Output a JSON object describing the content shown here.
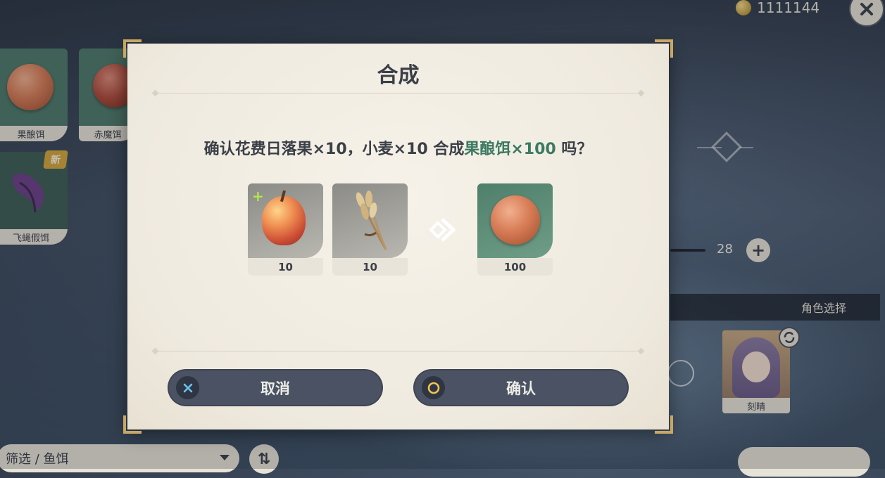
{
  "currency": {
    "amount": "1111144"
  },
  "left_cards": [
    {
      "label": "果酿饵"
    },
    {
      "label": "赤魔饵"
    },
    {
      "label": "飞蝇假饵",
      "badge": "新"
    }
  ],
  "right_panel": {
    "quantity": "28",
    "character_header": "角色选择",
    "character_name": "刻晴"
  },
  "filter": {
    "label": "筛选 / 鱼饵"
  },
  "dialog": {
    "title": "合成",
    "prompt_prefix": "确认花费日落果×10，小麦×10 合成",
    "prompt_highlight": "果酿饵×100",
    "prompt_suffix": " 吗？",
    "ingredients": [
      {
        "name": "日落果",
        "icon": "sunsettia-icon",
        "count": "10"
      },
      {
        "name": "小麦",
        "icon": "wheat-icon",
        "count": "10"
      }
    ],
    "result": {
      "name": "果酿饵",
      "icon": "fruit-paste-bait-icon",
      "count": "100"
    },
    "cancel_label": "取消",
    "confirm_label": "确认"
  },
  "colors": {
    "highlight": "#3c7a62",
    "button": "#4a5263",
    "panel": "#efeadf",
    "frame_gold": "#c8a664",
    "item_green": "#4f7f6b"
  }
}
